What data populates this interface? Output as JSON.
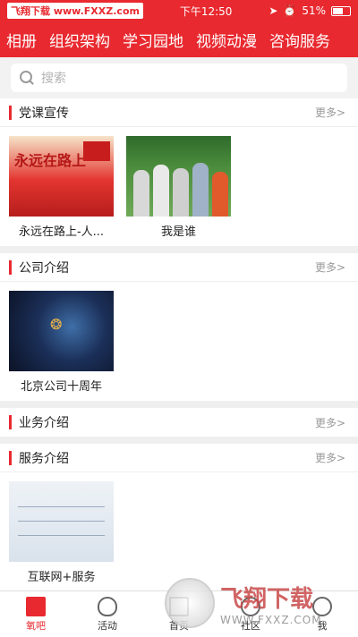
{
  "status_bar": {
    "watermark_text": "飞翔下载 www.FXXZ.com",
    "time": "下午12:50",
    "battery": "51%",
    "battery_level": 0.51
  },
  "nav": {
    "tabs": [
      "相册",
      "组织架构",
      "学习园地",
      "视频动漫",
      "咨询服务"
    ]
  },
  "search": {
    "placeholder": "搜索"
  },
  "sections": [
    {
      "title": "党课宣传",
      "more": "更多>",
      "items": [
        {
          "label": "永远在路上-人...",
          "thumb_text": "永远在路上"
        },
        {
          "label": "我是谁"
        }
      ]
    },
    {
      "title": "公司介绍",
      "more": "更多>",
      "items": [
        {
          "label": "北京公司十周年"
        }
      ]
    },
    {
      "title": "业务介绍",
      "more": "更多>",
      "items": []
    },
    {
      "title": "服务介绍",
      "more": "更多>",
      "items": [
        {
          "label": "互联网+服务"
        }
      ]
    }
  ],
  "tabbar": {
    "items": [
      {
        "label": "氧吧",
        "icon": "book-icon",
        "active": true
      },
      {
        "label": "活动",
        "icon": "balloon-icon",
        "active": false
      },
      {
        "label": "首页",
        "icon": "home-icon",
        "active": false
      },
      {
        "label": "社区",
        "icon": "community-icon",
        "active": false
      },
      {
        "label": "我",
        "icon": "me-icon",
        "active": false
      }
    ]
  },
  "watermark": {
    "main": "飞翔下载",
    "sub": "WWW.FXXZ.COM"
  },
  "colors": {
    "accent": "#e8292f"
  }
}
